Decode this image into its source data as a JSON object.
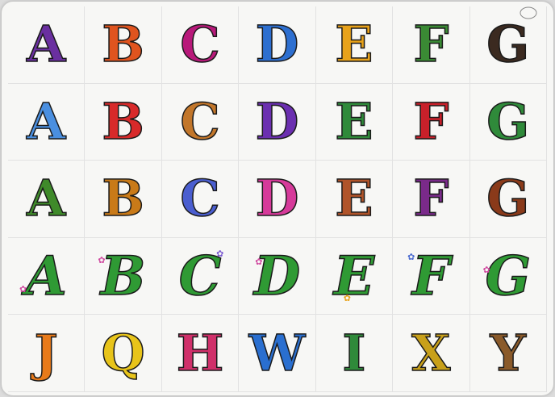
{
  "cells": [
    {
      "letter": "A",
      "fill": "#6a2fa0"
    },
    {
      "letter": "B",
      "fill": "#e0541f"
    },
    {
      "letter": "C",
      "fill": "#b8197a"
    },
    {
      "letter": "D",
      "fill": "#2d6fd0"
    },
    {
      "letter": "E",
      "fill": "#e8a21a"
    },
    {
      "letter": "F",
      "fill": "#3a8a34"
    },
    {
      "letter": "G",
      "fill": "#3b2a20"
    },
    {
      "letter": "A",
      "fill": "#4a8fe0"
    },
    {
      "letter": "B",
      "fill": "#d82a2a"
    },
    {
      "letter": "C",
      "fill": "#c2762a"
    },
    {
      "letter": "D",
      "fill": "#6b2fb0"
    },
    {
      "letter": "E",
      "fill": "#2f8a3a"
    },
    {
      "letter": "F",
      "fill": "#c8202a"
    },
    {
      "letter": "G",
      "fill": "#2f8a3a"
    },
    {
      "letter": "A",
      "fill": "#3f8a2a"
    },
    {
      "letter": "B",
      "fill": "#c97a18"
    },
    {
      "letter": "C",
      "fill": "#4a5ed0"
    },
    {
      "letter": "D",
      "fill": "#d63a9a"
    },
    {
      "letter": "E",
      "fill": "#b0542a"
    },
    {
      "letter": "F",
      "fill": "#7a2a8a"
    },
    {
      "letter": "G",
      "fill": "#8a3a1a"
    },
    {
      "letter": "A",
      "fill": "#2f9a34"
    },
    {
      "letter": "B",
      "fill": "#2f9a34"
    },
    {
      "letter": "C",
      "fill": "#2f9a34"
    },
    {
      "letter": "D",
      "fill": "#2f9a34"
    },
    {
      "letter": "E",
      "fill": "#2f9a34"
    },
    {
      "letter": "F",
      "fill": "#2f9a34"
    },
    {
      "letter": "G",
      "fill": "#2f9a34"
    },
    {
      "letter": "J",
      "fill": "#e87a1a"
    },
    {
      "letter": "Q",
      "fill": "#e8c41a"
    },
    {
      "letter": "H",
      "fill": "#d0306a"
    },
    {
      "letter": "W",
      "fill": "#2a6fd0"
    },
    {
      "letter": "I",
      "fill": "#2f8a3a"
    },
    {
      "letter": "X",
      "fill": "#c8a01a"
    },
    {
      "letter": "Y",
      "fill": "#8a5a2a"
    }
  ]
}
